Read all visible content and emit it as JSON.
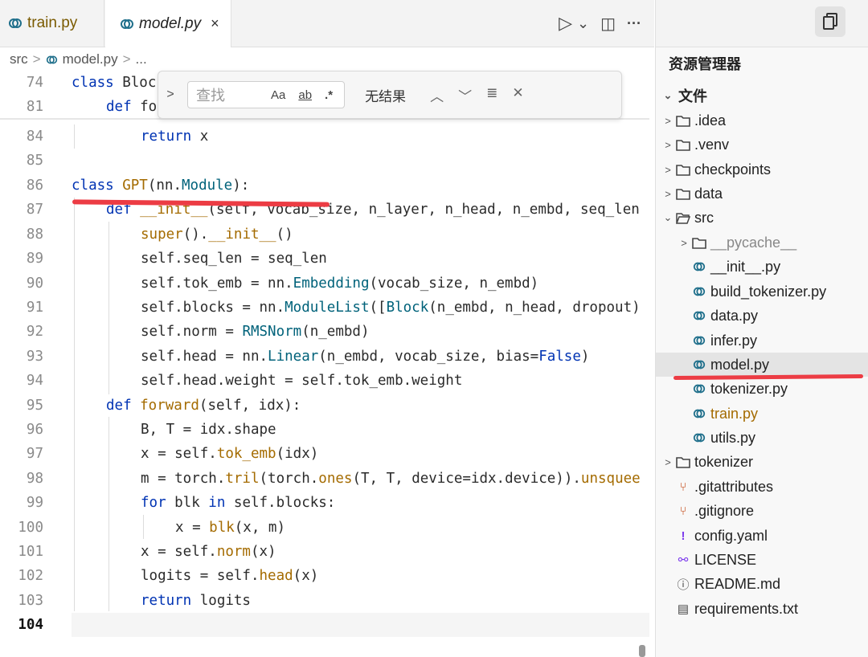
{
  "tabs": [
    {
      "label": "train.py",
      "active": false
    },
    {
      "label": "model.py",
      "active": true,
      "close": "×"
    }
  ],
  "tab_actions": {
    "run": "▷",
    "run_menu": "⌄",
    "split": "◫",
    "more": "···"
  },
  "breadcrumb": {
    "part1": "src",
    "sep1": ">",
    "part2": "model.py",
    "sep2": ">",
    "part3": "..."
  },
  "find": {
    "toggle": ">",
    "placeholder": "查找",
    "match_case": "Aa",
    "whole_word": "ab",
    "regex": ".*",
    "result": "无结果",
    "prev": "︿",
    "next": "﹀",
    "in_selection": "≣",
    "close": "✕"
  },
  "code": {
    "line_numbers": [
      "74",
      "81",
      "84",
      "85",
      "86",
      "87",
      "88",
      "89",
      "90",
      "91",
      "92",
      "93",
      "94",
      "95",
      "96",
      "97",
      "98",
      "99",
      "100",
      "101",
      "102",
      "103",
      "104"
    ],
    "sticky1": {
      "kw": "class",
      "rest": " Bloc"
    },
    "sticky2": {
      "kw": "def",
      "rest": " fo"
    },
    "l84": {
      "kw": "return",
      "rest": " x"
    },
    "l86": {
      "kw": "class",
      "name": " GPT",
      "p1": "(nn.",
      "mod": "Module",
      "p2": "):"
    },
    "l87": {
      "kw": "def",
      "name": " __init__",
      "rest": "(self, vocab_size, n_layer, n_head, n_embd, seq_len"
    },
    "l88": {
      "a": "super",
      "b": "().",
      "c": "__init__",
      "d": "()"
    },
    "l89": {
      "a": "self.seq_len = seq_len"
    },
    "l90": {
      "a": "self.tok_emb = nn.",
      "b": "Embedding",
      "c": "(vocab_size, n_embd)"
    },
    "l91": {
      "a": "self.blocks = nn.",
      "b": "ModuleList",
      "c": "([",
      "d": "Block",
      "e": "(n_embd, n_head, dropout)"
    },
    "l92": {
      "a": "self.norm = ",
      "b": "RMSNorm",
      "c": "(n_embd)"
    },
    "l93": {
      "a": "self.head = nn.",
      "b": "Linear",
      "c": "(n_embd, vocab_size, bias=",
      "d": "False",
      "e": ")"
    },
    "l94": {
      "a": "self.head.weight = self.tok_emb.weight"
    },
    "l95": {
      "kw": "def",
      "name": " forward",
      "rest": "(self, idx):"
    },
    "l96": {
      "a": "B, T = idx.shape"
    },
    "l97": {
      "a": "x = self.",
      "b": "tok_emb",
      "c": "(idx)"
    },
    "l98": {
      "a": "m = torch.",
      "b": "tril",
      "c": "(torch.",
      "d": "ones",
      "e": "(T, T, device=idx.device)).",
      "f": "unsquee"
    },
    "l99": {
      "kw": "for",
      "a": " blk ",
      "kw2": "in",
      "b": " self.blocks:"
    },
    "l100": {
      "a": "x = ",
      "b": "blk",
      "c": "(x, m)"
    },
    "l101": {
      "a": "x = self.",
      "b": "norm",
      "c": "(x)"
    },
    "l102": {
      "a": "logits = self.",
      "b": "head",
      "c": "(x)"
    },
    "l103": {
      "kw": "return",
      "rest": " logits"
    }
  },
  "explorer": {
    "title": "资源管理器",
    "section": "文件",
    "items": [
      {
        "label": ".idea",
        "type": "folder",
        "chev": ">"
      },
      {
        "label": ".venv",
        "type": "folder",
        "chev": ">"
      },
      {
        "label": "checkpoints",
        "type": "folder",
        "chev": ">"
      },
      {
        "label": "data",
        "type": "folder",
        "chev": ">"
      },
      {
        "label": "src",
        "type": "folder-open",
        "chev": "⌄"
      },
      {
        "label": "__pycache__",
        "type": "folder",
        "chev": ">"
      },
      {
        "label": "__init__.py",
        "type": "py"
      },
      {
        "label": "build_tokenizer.py",
        "type": "py"
      },
      {
        "label": "data.py",
        "type": "py"
      },
      {
        "label": "infer.py",
        "type": "py"
      },
      {
        "label": "model.py",
        "type": "py"
      },
      {
        "label": "tokenizer.py",
        "type": "py"
      },
      {
        "label": "train.py",
        "type": "py"
      },
      {
        "label": "utils.py",
        "type": "py"
      },
      {
        "label": "tokenizer",
        "type": "folder",
        "chev": ">"
      },
      {
        "label": ".gitattributes",
        "type": "git",
        "icon": "⑂"
      },
      {
        "label": ".gitignore",
        "type": "git",
        "icon": "⑂"
      },
      {
        "label": "config.yaml",
        "type": "yaml",
        "icon": "!"
      },
      {
        "label": "LICENSE",
        "type": "license",
        "icon": "⚯"
      },
      {
        "label": "README.md",
        "type": "info",
        "icon": "ⓘ"
      },
      {
        "label": "requirements.txt",
        "type": "txt",
        "icon": "▤"
      }
    ]
  },
  "colors": {
    "accent_underline": "#ec3c44",
    "keyword": "#0033b3",
    "function": "#a46b00",
    "module": "#00627a"
  }
}
